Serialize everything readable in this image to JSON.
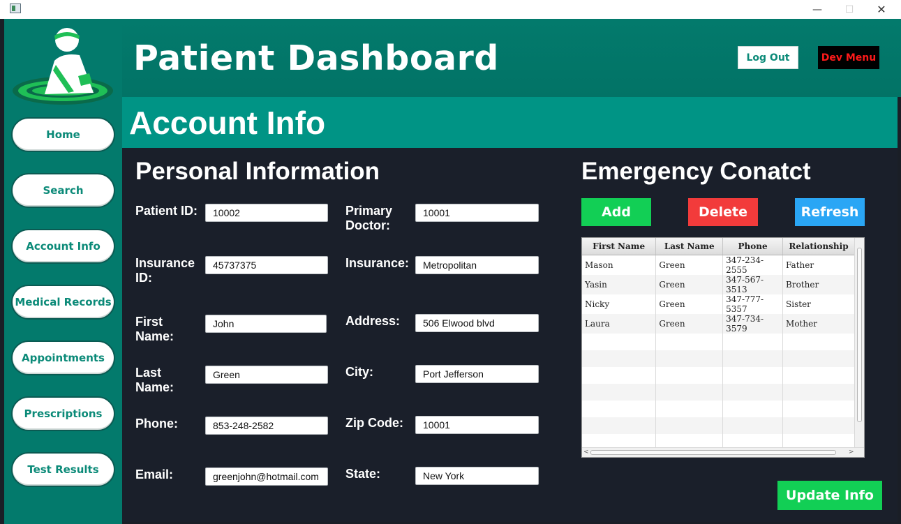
{
  "window": {
    "minimize_glyph": "—",
    "maximize_glyph": "☐",
    "close_glyph": "✕"
  },
  "header": {
    "title": "Patient Dashboard",
    "logout_label": "Log Out",
    "devmenu_label": "Dev Menu"
  },
  "sidebar": {
    "items": [
      {
        "label": "Home"
      },
      {
        "label": "Search"
      },
      {
        "label": "Account Info"
      },
      {
        "label": "Medical Records"
      },
      {
        "label": "Appointments"
      },
      {
        "label": "Prescriptions"
      },
      {
        "label": "Test Results"
      }
    ]
  },
  "section": {
    "title": "Account Info"
  },
  "personal": {
    "heading": "Personal Information",
    "fields": {
      "patient_id": {
        "label": "Patient ID:",
        "value": "10002"
      },
      "primary_doctor": {
        "label": "Primary Doctor:",
        "value": "10001"
      },
      "insurance_id": {
        "label": "Insurance ID:",
        "value": "45737375"
      },
      "insurance": {
        "label": "Insurance:",
        "value": "Metropolitan"
      },
      "first_name": {
        "label": "First Name:",
        "value": "John"
      },
      "address": {
        "label": "Address:",
        "value": "506 Elwood blvd"
      },
      "last_name": {
        "label": "Last Name:",
        "value": "Green"
      },
      "city": {
        "label": "City:",
        "value": "Port Jefferson"
      },
      "phone": {
        "label": "Phone:",
        "value": "853-248-2582"
      },
      "zip": {
        "label": "Zip Code:",
        "value": "10001"
      },
      "email": {
        "label": "Email:",
        "value": "greenjohn@hotmail.com"
      },
      "state": {
        "label": "State:",
        "value": "New York"
      }
    }
  },
  "emergency": {
    "heading": "Emergency Conatct",
    "add_label": "Add",
    "delete_label": "Delete",
    "refresh_label": "Refresh",
    "columns": [
      "First Name",
      "Last Name",
      "Phone",
      "Relationship"
    ],
    "rows": [
      [
        "Mason",
        "Green",
        "347-234-2555",
        "Father"
      ],
      [
        "Yasin",
        "Green",
        "347-567-3513",
        "Brother"
      ],
      [
        "Nicky",
        "Green",
        "347-777-5357",
        "Sister"
      ],
      [
        "Laura",
        "Green",
        "347-734-3579",
        "Mother"
      ]
    ],
    "colors": {
      "add": "#12cf55",
      "delete": "#f23b3b",
      "refresh": "#2aa6f5"
    }
  },
  "update_label": "Update Info",
  "colors": {
    "sidebar": "#037a6c",
    "section_bar": "#009485",
    "content_bg": "#1a1f2a",
    "update": "#12cf55",
    "devmenu_text": "#ff1a1a"
  }
}
